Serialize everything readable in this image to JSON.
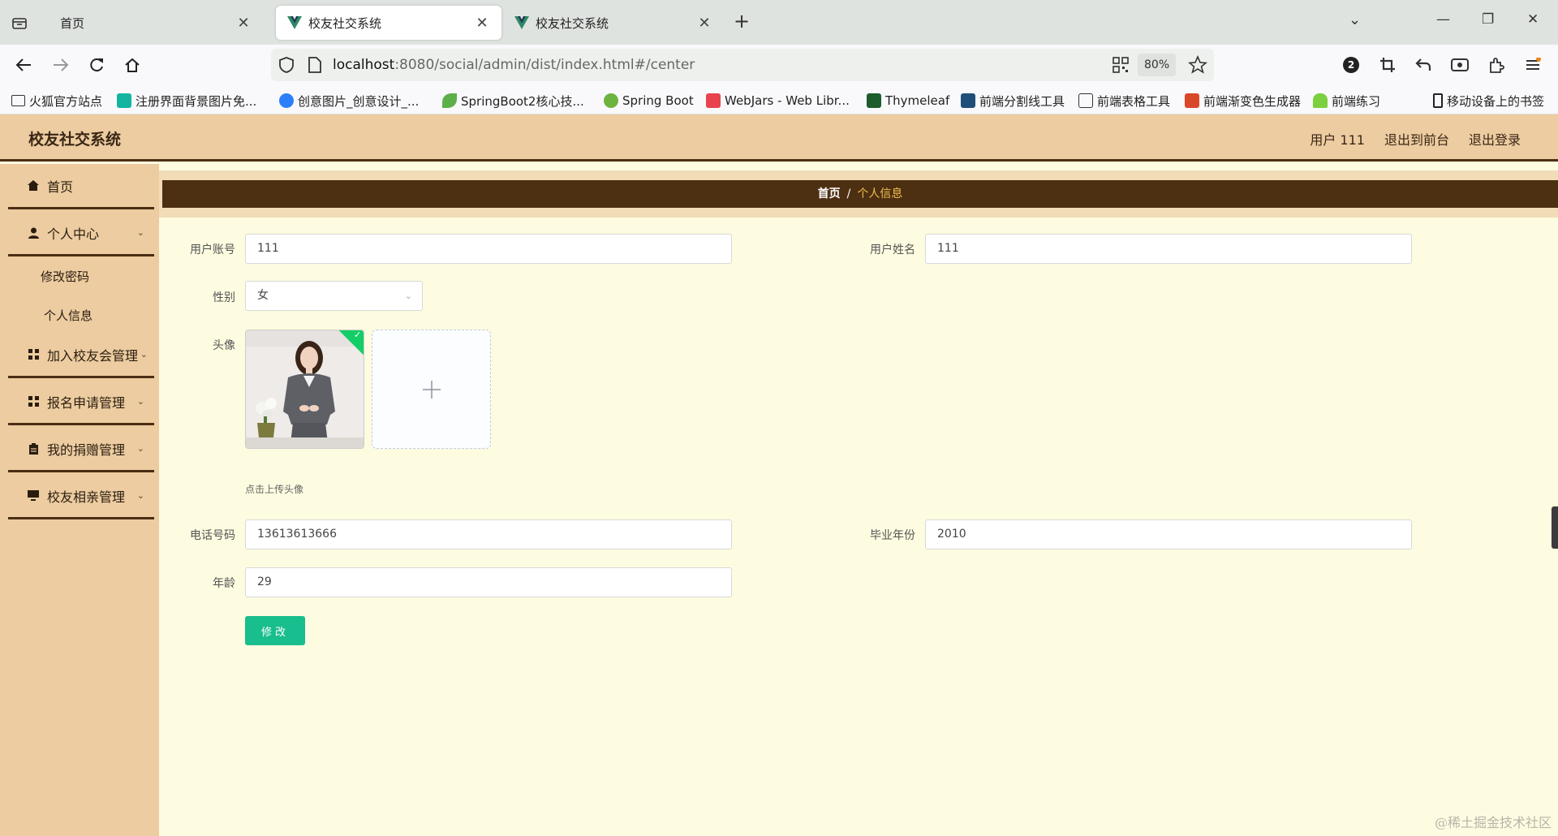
{
  "browser": {
    "tabs": [
      {
        "title": "首页",
        "active": false
      },
      {
        "title": "校友社交系统",
        "active": true
      },
      {
        "title": "校友社交系统",
        "active": false
      }
    ],
    "url_host": "localhost",
    "url_rest": ":8080/social/admin/dist/index.html#/center",
    "zoom": "80%",
    "extension_badge": "2",
    "bookmarks": [
      "火狐官方站点",
      "注册界面背景图片免...",
      "创意图片_创意设计_...",
      "SpringBoot2核心技...",
      "Spring Boot",
      "WebJars - Web Libr...",
      "Thymeleaf",
      "前端分割线工具",
      "前端表格工具",
      "前端渐变色生成器",
      "前端练习"
    ],
    "mobile_bookmarks": "移动设备上的书签"
  },
  "app": {
    "title": "校友社交系统",
    "header_links": [
      "用户 111",
      "退出到前台",
      "退出登录"
    ]
  },
  "sidebar": {
    "home": "首页",
    "personal_center": "个人中心",
    "sub_change_password": "修改密码",
    "sub_personal_info": "个人信息",
    "join_alumni": "加入校友会管理",
    "registration": "报名申请管理",
    "donation": "我的捐赠管理",
    "dating": "校友相亲管理"
  },
  "breadcrumb": {
    "home": "首页",
    "separator": "/",
    "current": "个人信息"
  },
  "form": {
    "account_label": "用户账号",
    "account_value": "111",
    "name_label": "用户姓名",
    "name_value": "111",
    "gender_label": "性别",
    "gender_value": "女",
    "avatar_label": "头像",
    "avatar_tip": "点击上传头像",
    "phone_label": "电话号码",
    "phone_value": "13613613666",
    "grad_year_label": "毕业年份",
    "grad_year_value": "2010",
    "age_label": "年龄",
    "age_value": "29",
    "submit_label": "修改"
  },
  "watermark": "@稀土掘金技术社区",
  "colors": {
    "header_bg": "#ecccA0",
    "breadcrumb_bar": "#4d2f12",
    "breadcrumb_current": "#f0c050",
    "page_bg": "#fdfbe0",
    "submit_button": "#19be8e"
  }
}
